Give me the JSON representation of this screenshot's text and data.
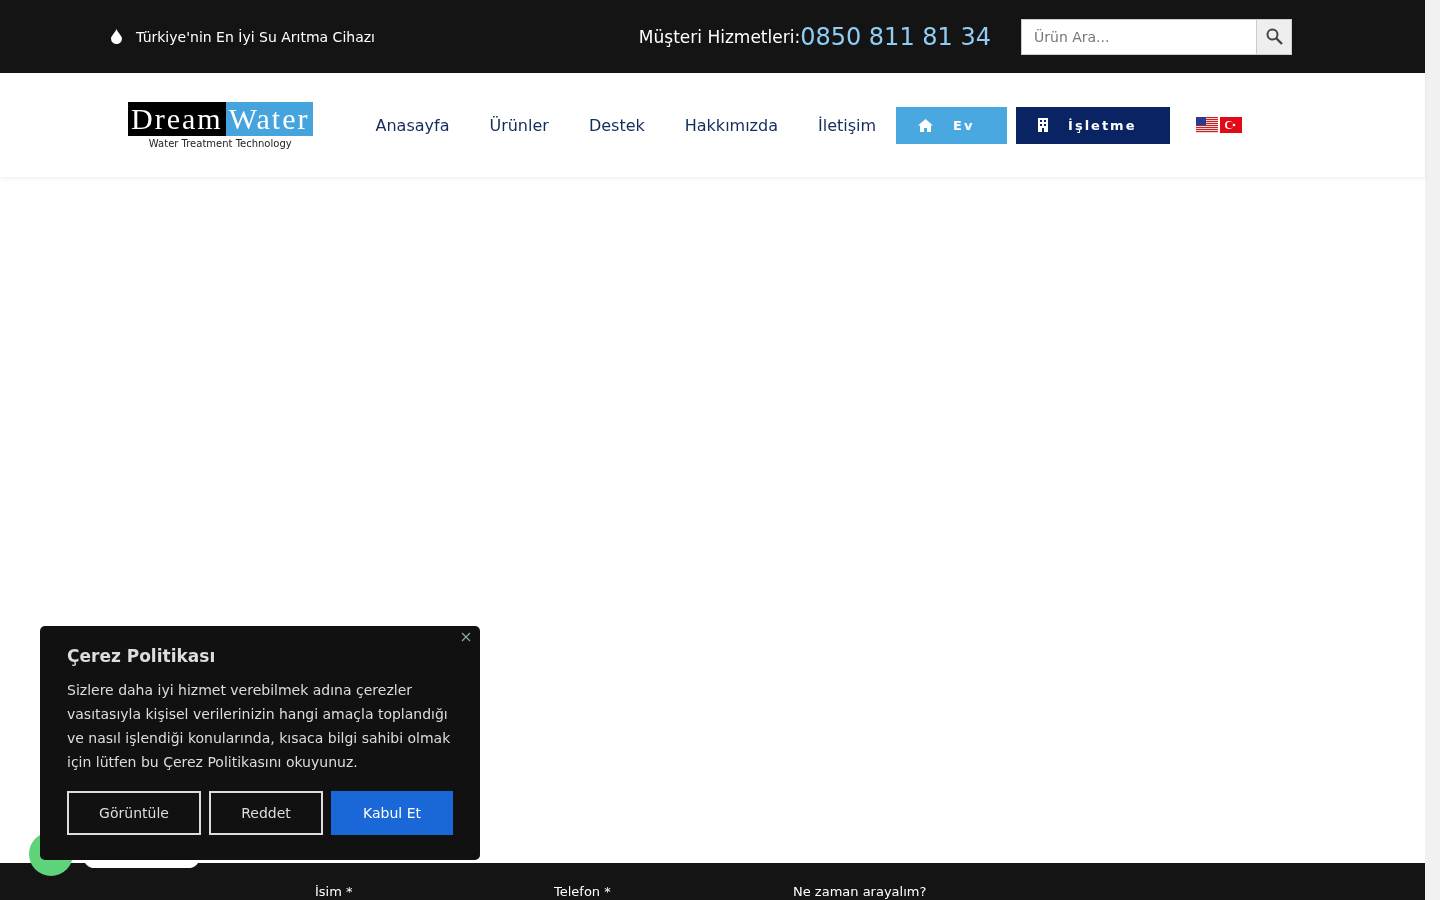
{
  "topbar": {
    "tagline": "Türkiye'nin En İyi Su Arıtma Cihazı",
    "service_label": "Müşteri Hizmetleri:",
    "phone": "0850 811 81 34",
    "search": {
      "placeholder": "Ürün Ara..."
    }
  },
  "logo": {
    "word_1": "Dream",
    "word_2": "Water",
    "subtitle": "Water Treatment Technology"
  },
  "nav": {
    "links": [
      "Anasayfa",
      "Ürünler",
      "Destek",
      "Hakkımızda",
      "İletişim"
    ],
    "buttons": [
      {
        "label": "Ev",
        "kind": "home"
      },
      {
        "label": "İşletme",
        "kind": "business"
      }
    ],
    "languages": [
      {
        "kind": "us"
      },
      {
        "kind": "tr"
      }
    ]
  },
  "footer_form": {
    "labels": [
      "İsim *",
      "Telefon *",
      "Ne zaman arayalım?"
    ]
  },
  "cookie": {
    "title": "Çerez Politikası",
    "text": "Sizlere daha iyi hizmet verebilmek adına çerezler vasıtasıyla kişisel verilerinizin hangi amaçla toplandığı ve nasıl işlendiği konularında, kısaca bilgi sahibi olmak için lütfen bu Çerez Politikasını okuyunuz.",
    "buttons": [
      {
        "label": "Görüntüle",
        "kind": "outline"
      },
      {
        "label": "Reddet",
        "kind": "outline"
      },
      {
        "label": "Kabul Et",
        "kind": "primary"
      }
    ]
  }
}
